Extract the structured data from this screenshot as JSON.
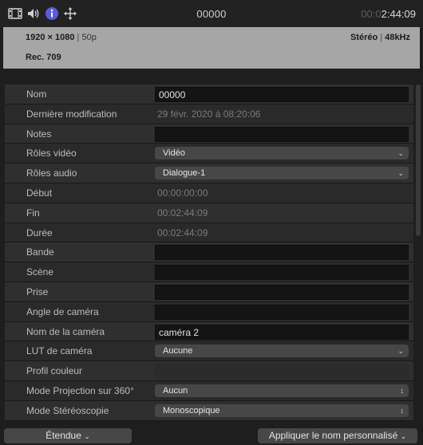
{
  "toolbar": {
    "title": "00000",
    "time_dim": "00:0",
    "time_bright": "2:44:09",
    "icons": [
      "film-icon",
      "speaker-icon",
      "info-icon",
      "share-icon"
    ],
    "info_color": "#5a5ae0"
  },
  "info": {
    "resolution": "1920 × 1080",
    "separator": "|",
    "frame_rate": "50p",
    "audio_channels": "Stéréo",
    "audio_rate": "48kHz",
    "color_space": "Rec. 709"
  },
  "properties": [
    {
      "label": "Nom",
      "type": "field",
      "value": "00000"
    },
    {
      "label": "Dernière modification",
      "type": "text",
      "value": "29 févr. 2020 à 08:20:06"
    },
    {
      "label": "Notes",
      "type": "field",
      "value": ""
    },
    {
      "label": "Rôles vidéo",
      "type": "popup",
      "value": "Vidéo"
    },
    {
      "label": "Rôles audio",
      "type": "popup",
      "value": "Dialogue-1"
    },
    {
      "label": "Début",
      "type": "text",
      "value": "00:00:00:00"
    },
    {
      "label": "Fin",
      "type": "text",
      "value": "00:02:44:09"
    },
    {
      "label": "Durée",
      "type": "text",
      "value": "00:02:44:09"
    },
    {
      "label": "Bande",
      "type": "field",
      "value": ""
    },
    {
      "label": "Scène",
      "type": "field",
      "value": ""
    },
    {
      "label": "Prise",
      "type": "field",
      "value": ""
    },
    {
      "label": "Angle de caméra",
      "type": "field",
      "value": ""
    },
    {
      "label": "Nom de la caméra",
      "type": "field",
      "value": "caméra 2"
    },
    {
      "label": "LUT de caméra",
      "type": "popup",
      "value": "Aucune"
    },
    {
      "label": "Profil couleur",
      "type": "dim",
      "value": ""
    },
    {
      "label": "Mode Projection sur 360°",
      "type": "popup",
      "value": "Aucun"
    },
    {
      "label": "Mode Stéréoscopie",
      "type": "popup",
      "value": "Monoscopique"
    }
  ],
  "bottom": {
    "view_button": "Étendue",
    "apply_button": "Appliquer le nom personnalisé"
  }
}
